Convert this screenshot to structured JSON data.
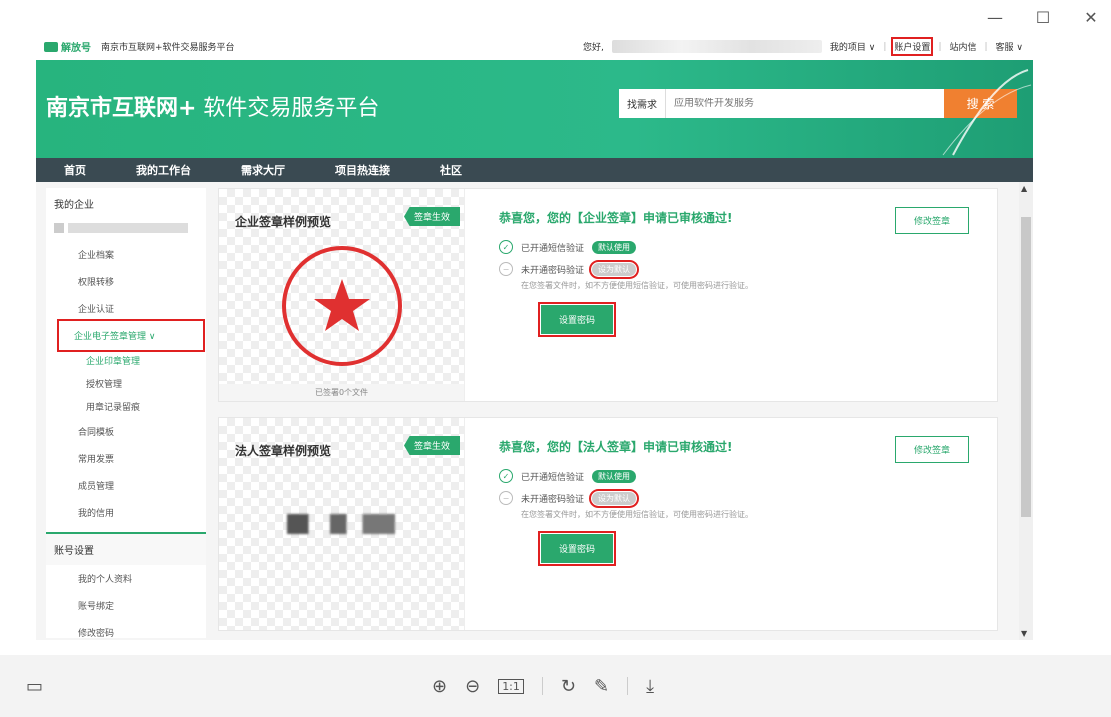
{
  "window": {
    "minimize": "—",
    "maximize": "☐",
    "close": "✕"
  },
  "topbar": {
    "logo": "解放号",
    "site_name": "南京市互联网+软件交易服务平台",
    "greeting": "您好,",
    "menu": [
      "我的项目 ∨",
      "账户设置",
      "站内信",
      "客服 ∨"
    ]
  },
  "banner": {
    "title_bold": "南京市互联网+",
    "title_normal": " 软件交易服务平台",
    "search_label": "找需求",
    "search_placeholder": "应用软件开发服务",
    "search_button": "搜 索"
  },
  "nav": [
    "首页",
    "我的工作台",
    "需求大厅",
    "项目热连接",
    "社区"
  ],
  "sidebar": {
    "section1": "我的企业",
    "items": [
      "企业档案",
      "权限转移",
      "企业认证"
    ],
    "esign": "企业电子签章管理 ∨",
    "esign_subs": [
      "企业印章管理",
      "授权管理",
      "用章记录留痕"
    ],
    "items2": [
      "合同模板",
      "常用发票",
      "成员管理",
      "我的信用"
    ],
    "section2": "账号设置",
    "account_items": [
      "我的个人资料",
      "账号绑定",
      "修改密码"
    ]
  },
  "panels": [
    {
      "preview_title": "企业签章样例预览",
      "ribbon": "签章生效",
      "footer": "已签署0个文件",
      "success": "恭喜您，您的【企业签章】申请已审核通过!",
      "sms": "已开通短信验证",
      "sms_badge": "默认使用",
      "pwd": "未开通密码验证",
      "pwd_badge": "设为默认",
      "hint": "在您签署文件时，如不方便使用短信验证，可使用密码进行验证。",
      "set_button": "设置密码",
      "modify_button": "修改签章"
    },
    {
      "preview_title": "法人签章样例预览",
      "ribbon": "签章生效",
      "success": "恭喜您，您的【法人签章】申请已审核通过!",
      "sms": "已开通短信验证",
      "sms_badge": "默认使用",
      "pwd": "未开通密码验证",
      "pwd_badge": "设为默认",
      "hint": "在您签署文件时，如不方便使用短信验证，可使用密码进行验证。",
      "set_button": "设置密码",
      "modify_button": "修改签章"
    }
  ],
  "toolbar": {
    "icons": [
      "thumbnail-icon",
      "zoom-in-icon",
      "zoom-out-icon",
      "actual-size-icon",
      "rotate-icon",
      "edit-icon",
      "download-icon"
    ],
    "actual_size": "1:1"
  },
  "colors": {
    "brand": "#2aa86d",
    "highlight": "#e02020",
    "search_button": "#f08030",
    "nav": "#3a4a52"
  }
}
